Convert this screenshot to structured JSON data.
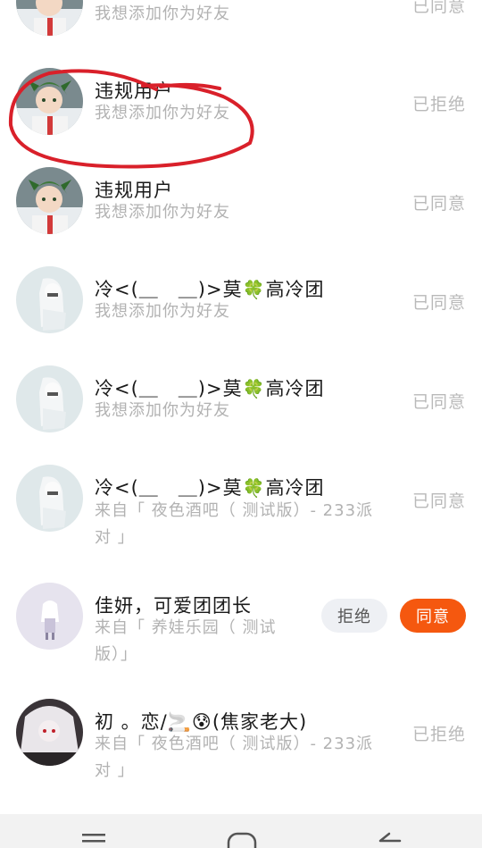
{
  "requests": [
    {
      "name": "",
      "subtitle": "我想添加你为好友",
      "status": "已同意",
      "avatar": "green-hair-boy"
    },
    {
      "name": "违规用户",
      "subtitle": "我想添加你为好友",
      "status": "已拒绝",
      "avatar": "green-hair-boy"
    },
    {
      "name": "违规用户",
      "subtitle": "我想添加你为好友",
      "status": "已同意",
      "avatar": "green-hair-boy"
    },
    {
      "name": "冷<(＿　＿)>莫",
      "name_suffix": "高冷团",
      "subtitle": "我想添加你为好友",
      "status": "已同意",
      "avatar": "white-hair-girl"
    },
    {
      "name": "冷<(＿　＿)>莫",
      "name_suffix": "高冷团",
      "subtitle": "我想添加你为好友",
      "status": "已同意",
      "avatar": "white-hair-girl"
    },
    {
      "name": "冷<(＿　＿)>莫",
      "name_suffix": "高冷团",
      "subtitle": "来自「 夜色酒吧（ 测试版）- 233派对 」",
      "status": "已同意",
      "avatar": "white-hair-girl"
    },
    {
      "name": "佳妍，可爱团团长",
      "subtitle": "来自「 养娃乐园（ 测试版）」",
      "reject_label": "拒绝",
      "accept_label": "同意",
      "avatar": "chibi-doll"
    },
    {
      "name": "初 。恋/",
      "name_suffix": "(焦家老大)",
      "subtitle": "来自「 夜色酒吧（ 测试版）- 233派对 」",
      "status": "已拒绝",
      "avatar": "dark-anime"
    }
  ],
  "colors": {
    "accent": "#f5580f",
    "status_text": "#b9b9b9",
    "annotation": "#d9202a"
  },
  "icons": {
    "clover": "🍀",
    "cigarette": "🚬",
    "sad_face": "😰"
  }
}
